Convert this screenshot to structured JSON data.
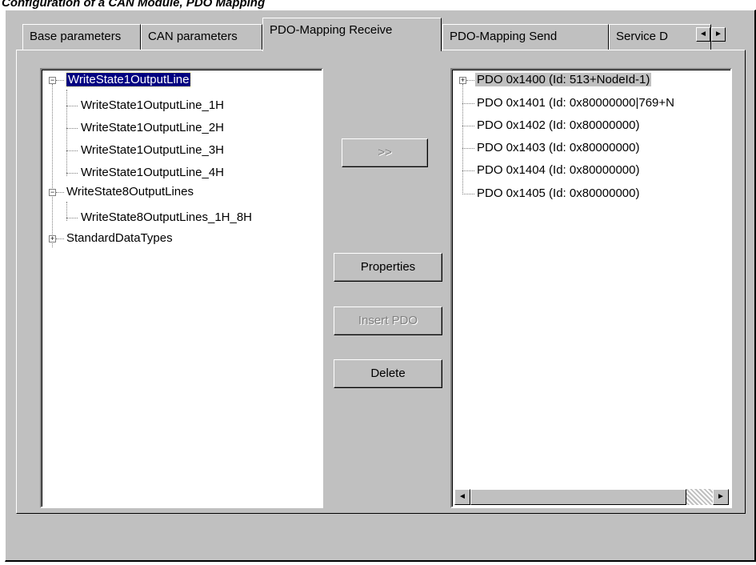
{
  "caption": "Configuration of a CAN Module, PDO Mapping",
  "tabs": [
    {
      "label": "Base parameters",
      "active": false
    },
    {
      "label": "CAN parameters",
      "active": false
    },
    {
      "label": "PDO-Mapping Receive",
      "active": true
    },
    {
      "label": "PDO-Mapping Send",
      "active": false
    },
    {
      "label": "Service D",
      "active": false
    }
  ],
  "tab_scroll": {
    "left": "◄",
    "right": "►"
  },
  "left_tree": [
    {
      "label": "WriteState1OutputLine",
      "level": 0,
      "expander": "−",
      "selected": true
    },
    {
      "label": "WriteState1OutputLine_1H",
      "level": 1
    },
    {
      "label": "WriteState1OutputLine_2H",
      "level": 1
    },
    {
      "label": "WriteState1OutputLine_3H",
      "level": 1
    },
    {
      "label": "WriteState1OutputLine_4H",
      "level": 1
    },
    {
      "label": "WriteState8OutputLines",
      "level": 0,
      "expander": "−"
    },
    {
      "label": "WriteState8OutputLines_1H_8H",
      "level": 1
    },
    {
      "label": "StandardDataTypes",
      "level": 0,
      "expander": "+"
    }
  ],
  "buttons": {
    "add": ">>",
    "properties": "Properties",
    "insert_pdo": "Insert PDO",
    "delete": "Delete"
  },
  "right_tree": [
    {
      "label": "PDO 0x1400 (Id: 513+NodeId-1)",
      "expander": "+",
      "highlighted": true
    },
    {
      "label": "PDO 0x1401 (Id: 0x80000000|769+N"
    },
    {
      "label": "PDO 0x1402 (Id: 0x80000000)"
    },
    {
      "label": "PDO 0x1403 (Id: 0x80000000)"
    },
    {
      "label": "PDO 0x1404 (Id: 0x80000000)"
    },
    {
      "label": "PDO 0x1405 (Id: 0x80000000)"
    }
  ],
  "hscroll": {
    "left": "◄",
    "right": "►"
  }
}
